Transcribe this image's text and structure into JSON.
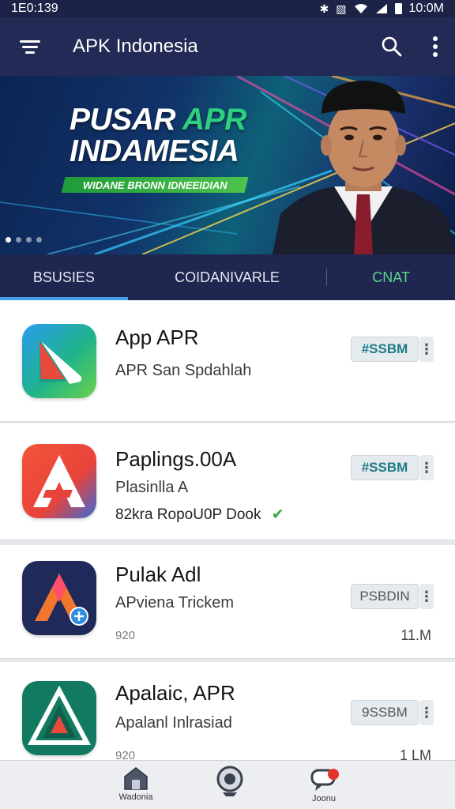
{
  "status_bar": {
    "left_time": "1E0:139",
    "right_time": "10:0M"
  },
  "app_bar": {
    "title": "APK Indonesia"
  },
  "banner": {
    "headline_line1_a": "PUSAR",
    "headline_line1_b": "APR",
    "headline_line2": "INDAMESIA",
    "ribbon_text": "WIDANE BRONN IDNEEIDIAN",
    "dots": 4,
    "active_dot": 0
  },
  "tabs": [
    {
      "label": "BSUSIES",
      "active": true
    },
    {
      "label": "COIDANIVARLE",
      "active": false
    },
    {
      "label": "CNAT",
      "active": false
    }
  ],
  "apps": [
    {
      "name": "App APR",
      "subtitle": "APR San Spdahlah",
      "chip": "#SSBM"
    },
    {
      "name": "Paplings.00A",
      "subtitle": "Plasinlla A",
      "subtitle2": "82kra RopoU0P Dook",
      "chip": "#SSBM"
    },
    {
      "name": "Pulak Adl",
      "subtitle": "APviena Trickem",
      "meta": "920",
      "chip": "PSBDIN",
      "size": "11.M"
    },
    {
      "name": "Apalaic, APR",
      "subtitle": "Apalanl Inlrasiad",
      "meta": "920",
      "chip": "9SSBM",
      "size": "1 LM"
    }
  ],
  "bottom_nav": [
    {
      "label": "Wadonia",
      "icon": "home-icon"
    },
    {
      "label": "",
      "icon": "explore-icon"
    },
    {
      "label": "Joonu",
      "icon": "chat-icon",
      "badge": true
    }
  ],
  "colors": {
    "app_bar": "#232a55",
    "tabs": "#1f2650",
    "tab_indicator": "#3fa0e8",
    "accent_green": "#2ecf7f"
  }
}
